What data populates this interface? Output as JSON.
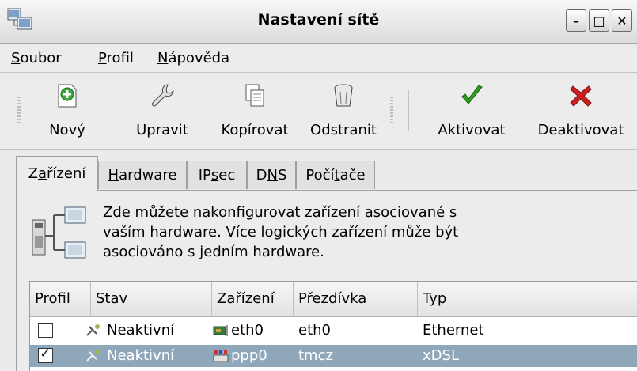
{
  "window": {
    "title": "Nastavení sítě",
    "buttons": {
      "minimize": "–",
      "maximize": "□",
      "close": "✕"
    }
  },
  "menu": [
    {
      "accel": "S",
      "rest": "oubor"
    },
    {
      "accel": "P",
      "rest": "rofil"
    },
    {
      "accel": "N",
      "rest": "ápověda"
    }
  ],
  "toolbar": {
    "new": "Nový",
    "edit": "Upravit",
    "copy": "Kopírovat",
    "delete": "Odstranit",
    "activate": "Aktivovat",
    "deactivate": "Deaktivovat"
  },
  "tabs": {
    "devices": {
      "pre": "Z",
      "accel": "a",
      "post": "řízení"
    },
    "hardware": {
      "pre": "",
      "accel": "H",
      "post": "ardware"
    },
    "ipsec": {
      "pre": "IP",
      "accel": "s",
      "post": "ec"
    },
    "dns": {
      "pre": "D",
      "accel": "N",
      "post": "S"
    },
    "hosts": {
      "pre": "Počí",
      "accel": "t",
      "post": "ače"
    }
  },
  "info": {
    "line1": "Zde můžete nakonfigurovat zařízení asociované s",
    "line2": "vaším hardware. Více logických zařízení může být",
    "line3": "asociováno s jedním hardware."
  },
  "table": {
    "headers": {
      "profile": "Profil",
      "status": "Stav",
      "device": "Zařízení",
      "nickname": "Přezdívka",
      "type": "Typ"
    },
    "rows": [
      {
        "checked": false,
        "status": "Neaktivní",
        "device": "eth0",
        "nickname": "eth0",
        "type": "Ethernet"
      },
      {
        "checked": true,
        "status": "Neaktivní",
        "device": "ppp0",
        "nickname": "tmcz",
        "type": "xDSL"
      }
    ]
  },
  "colors": {
    "selection": "#8fa7bb",
    "accent_green": "#2fa020",
    "accent_red": "#cc2020"
  }
}
